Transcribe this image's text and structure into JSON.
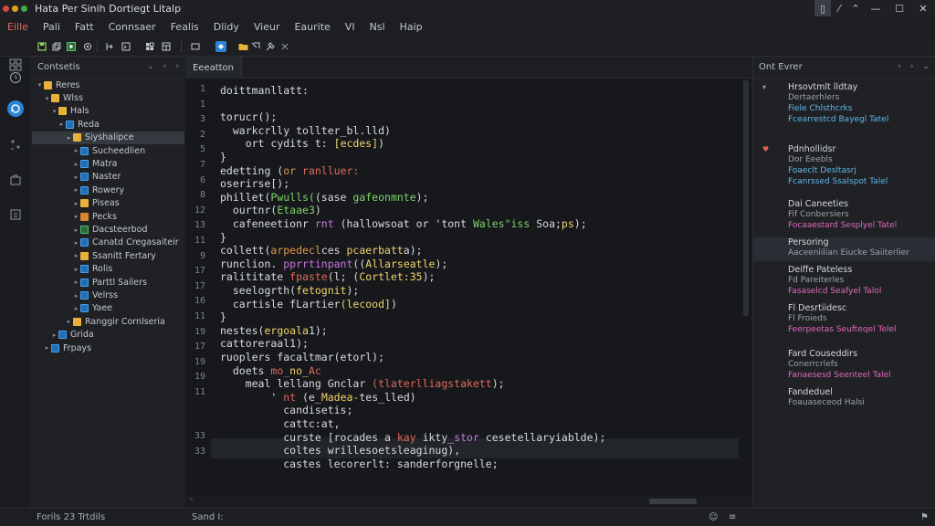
{
  "window": {
    "title": "Hata Per Sinih Dortiegt Litalp",
    "controls": [
      "▯",
      "⁄",
      "⌃",
      "—",
      "☐",
      "✕"
    ]
  },
  "colors": {
    "dot_red": "#e0443e",
    "dot_yellow": "#dea123",
    "dot_green": "#3fae3f",
    "accent": "#2a83d6"
  },
  "menu": [
    "Eille",
    "Pali",
    "Fatt",
    "Connsaer",
    "Fealis",
    "Dlidy",
    "Vieur",
    "Eaurite",
    "VI",
    "Nsl",
    "Haip"
  ],
  "toolbar": {
    "icons": [
      "save-icon",
      "copy-icon",
      "run-icon",
      "debug-icon",
      "split-icon",
      "terminal-icon",
      "extensions-icon",
      "layout-icon",
      "window-icon",
      "tab-icon",
      "folder-icon",
      "settings-icon",
      "tools-icon"
    ]
  },
  "activity": [
    "explorer-icon",
    "clock-icon",
    "account-icon",
    "extensions-icon",
    "debug-icon",
    "source-icon"
  ],
  "explorer": {
    "header": "Contsetis",
    "header_icons": [
      "⌄",
      "‹",
      "›"
    ],
    "items": [
      {
        "label": "Reres",
        "depth": 1,
        "icon": "folder",
        "chev": "▾"
      },
      {
        "label": "Wlss",
        "depth": 2,
        "icon": "folder",
        "chev": "▾"
      },
      {
        "label": "Hals",
        "depth": 3,
        "icon": "folder",
        "chev": "▾"
      },
      {
        "label": "Reda",
        "depth": 4,
        "icon": "file",
        "chev": "▸"
      },
      {
        "label": "Siyshalipce",
        "depth": 5,
        "icon": "folder",
        "chev": "▸",
        "selected": true
      },
      {
        "label": "Sucheedlien",
        "depth": 6,
        "icon": "file",
        "chev": "▸"
      },
      {
        "label": "Matra",
        "depth": 6,
        "icon": "file",
        "chev": "▸"
      },
      {
        "label": "Naster",
        "depth": 6,
        "icon": "file",
        "chev": "▸"
      },
      {
        "label": "Rowery",
        "depth": 6,
        "icon": "file",
        "chev": "▸"
      },
      {
        "label": "Piseas",
        "depth": 6,
        "icon": "folder",
        "chev": "▸"
      },
      {
        "label": "Pecks",
        "depth": 6,
        "icon": "orange",
        "chev": "▸"
      },
      {
        "label": "Dacsteerbod",
        "depth": 6,
        "icon": "green",
        "chev": "▸"
      },
      {
        "label": "Canatd Cregasaiteir",
        "depth": 6,
        "icon": "file",
        "chev": "▸"
      },
      {
        "label": "Ssanitt Fertary",
        "depth": 6,
        "icon": "folder",
        "chev": "▸"
      },
      {
        "label": "Rolis",
        "depth": 6,
        "icon": "file",
        "chev": "▸"
      },
      {
        "label": "Parttl Sailers",
        "depth": 6,
        "icon": "file",
        "chev": "▸"
      },
      {
        "label": "Velrss",
        "depth": 6,
        "icon": "file",
        "chev": "▸"
      },
      {
        "label": "Yaee",
        "depth": 6,
        "icon": "file",
        "chev": "▸"
      },
      {
        "label": "Ranggir Cornlseria",
        "depth": 5,
        "icon": "folder",
        "chev": "▸"
      },
      {
        "label": "Grida",
        "depth": 3,
        "icon": "file",
        "chev": "▸"
      },
      {
        "label": "Frpays",
        "depth": 2,
        "icon": "file",
        "chev": "▸"
      }
    ]
  },
  "editor": {
    "tab": "Eeeatton",
    "line_numbers": [
      "1",
      "1",
      "3",
      "2",
      "5",
      "7",
      "6",
      "8",
      "12",
      "13",
      "11",
      "9",
      "17",
      "17",
      "16",
      "11",
      "19",
      "17",
      "19",
      "19",
      "11",
      "33",
      "33"
    ],
    "lines": [
      [
        {
          "t": "doittmanllatt:",
          "c": "w"
        }
      ],
      [
        {
          "t": "",
          "c": "w"
        }
      ],
      [
        {
          "t": "torucr();",
          "c": "w"
        }
      ],
      [
        {
          "t": "  warkcrlly ",
          "c": "w"
        },
        {
          "t": "tollter_",
          "c": "w"
        },
        {
          "t": "bl.lld)",
          "c": "w"
        }
      ],
      [
        {
          "t": "    ort ",
          "c": "w"
        },
        {
          "t": "cydits",
          "c": "w"
        },
        {
          "t": " t: ",
          "c": "w"
        },
        {
          "t": "[ecdes]",
          "c": "y"
        },
        {
          "t": ")",
          "c": "w"
        }
      ],
      [
        {
          "t": "}",
          "c": "w"
        }
      ],
      [
        {
          "t": "edetting ",
          "c": "w"
        },
        {
          "t": "(",
          "c": "w"
        },
        {
          "t": "or ",
          "c": "o"
        },
        {
          "t": "ranlluer:",
          "c": "r"
        }
      ],
      [
        {
          "t": "oserirse[);",
          "c": "w"
        }
      ],
      [
        {
          "t": "phillet(",
          "c": "w"
        },
        {
          "t": "Pwulls(",
          "c": "g"
        },
        {
          "t": "(sase ",
          "c": "w"
        },
        {
          "t": "gafeonmnte",
          "c": "g"
        },
        {
          "t": ");",
          "c": "w"
        }
      ],
      [
        {
          "t": "  ourtnr",
          "c": "w"
        },
        {
          "t": "(",
          "c": "w"
        },
        {
          "t": "Etaae3",
          "c": "g"
        },
        {
          "t": ")",
          "c": "w"
        }
      ],
      [
        {
          "t": "  cafeneetionr ",
          "c": "w"
        },
        {
          "t": "rnt ",
          "c": "p"
        },
        {
          "t": "(hallowsoat or 'tont ",
          "c": "w"
        },
        {
          "t": "Wales\"iss ",
          "c": "g"
        },
        {
          "t": "Soa;",
          "c": "w"
        },
        {
          "t": "ps",
          "c": "y"
        },
        {
          "t": ");",
          "c": "w"
        }
      ],
      [
        {
          "t": "}",
          "c": "w"
        }
      ],
      [
        {
          "t": "collett(",
          "c": "w"
        },
        {
          "t": "arpedecl",
          "c": "o"
        },
        {
          "t": "ces ",
          "c": "w"
        },
        {
          "t": "pcaerbatt",
          "c": "y"
        },
        {
          "t": "a);",
          "c": "w"
        }
      ],
      [
        {
          "t": "runclion. ",
          "c": "w"
        },
        {
          "t": "pprrtinpant",
          "c": "p"
        },
        {
          "t": "((",
          "c": "w"
        },
        {
          "t": "Allarseatle",
          "c": "y"
        },
        {
          "t": ");",
          "c": "w"
        }
      ],
      [
        {
          "t": "ralititate ",
          "c": "w"
        },
        {
          "t": "fpaste",
          "c": "r"
        },
        {
          "t": "(l; (",
          "c": "w"
        },
        {
          "t": "Cortlet:35",
          "c": "y"
        },
        {
          "t": ");",
          "c": "w"
        }
      ],
      [
        {
          "t": "  seelogrth(",
          "c": "w"
        },
        {
          "t": "fetognit",
          "c": "y"
        },
        {
          "t": ");",
          "c": "w"
        }
      ],
      [
        {
          "t": "  cartisle ",
          "c": "w"
        },
        {
          "t": "fLartier",
          "c": "w"
        },
        {
          "t": "(lecood]",
          "c": "y"
        },
        {
          "t": ")",
          "c": "w"
        }
      ],
      [
        {
          "t": "}",
          "c": "w"
        }
      ],
      [
        {
          "t": "nestes(",
          "c": "w"
        },
        {
          "t": "ergoala",
          "c": "y"
        },
        {
          "t": "1);",
          "c": "w"
        }
      ],
      [
        {
          "t": "cattoreraal",
          "c": "w"
        },
        {
          "t": "1",
          "c": "w"
        },
        {
          "t": ");",
          "c": "w"
        }
      ],
      [
        {
          "t": "ruoplers ",
          "c": "w"
        },
        {
          "t": "facaltmar",
          "c": "w"
        },
        {
          "t": "(etorl);",
          "c": "w"
        }
      ],
      [
        {
          "t": "  doets ",
          "c": "w"
        },
        {
          "t": "mo_",
          "c": "r"
        },
        {
          "t": "no_",
          "c": "y"
        },
        {
          "t": "Ac",
          "c": "r"
        }
      ],
      [
        {
          "t": "    meal ",
          "c": "w"
        },
        {
          "t": "lellang ",
          "c": "w"
        },
        {
          "t": "Gnclar ",
          "c": "w"
        },
        {
          "t": "(tlaterlliagstakett",
          "c": "r"
        },
        {
          "t": ");",
          "c": "w"
        }
      ],
      [
        {
          "t": "        ' ",
          "c": "w"
        },
        {
          "t": "nt ",
          "c": "r"
        },
        {
          "t": "(e_",
          "c": "w"
        },
        {
          "t": "Madea-",
          "c": "y"
        },
        {
          "t": "tes_lled)",
          "c": "w"
        }
      ],
      [
        {
          "t": "          candisetis;",
          "c": "w"
        }
      ],
      [
        {
          "t": "          cattc:at,",
          "c": "w"
        }
      ],
      [
        {
          "t": "          curste ",
          "c": "w"
        },
        {
          "t": "[rocades ",
          "c": "w"
        },
        {
          "t": "a ",
          "c": "w"
        },
        {
          "t": "kay ",
          "c": "r"
        },
        {
          "t": "ikty_",
          "c": "w"
        },
        {
          "t": "stor ",
          "c": "p"
        },
        {
          "t": "cesetellaryiablde);",
          "c": "w"
        }
      ],
      [
        {
          "t": "          coltes ",
          "c": "w"
        },
        {
          "t": "wrillesoetsleaginug)",
          "c": "w"
        },
        {
          "t": ",",
          "c": "w"
        }
      ],
      [
        {
          "t": "          castes ",
          "c": "w"
        },
        {
          "t": "lecorerlt",
          "c": "w"
        },
        {
          "t": ": ",
          "c": "w"
        },
        {
          "t": "sanderforgnelle;",
          "c": "w"
        }
      ]
    ]
  },
  "outline": {
    "header": "Ont Evrer",
    "header_icons": [
      "‹",
      "›",
      "⌄"
    ],
    "items": [
      {
        "title": "Hrsovtmlt lldtay",
        "sub": "Dertaerhlers",
        "link": "Fiele Chlsthcrks",
        "extra": "Fcearrestcd Bayegl Tatel"
      },
      {
        "title": "Pdnhollidsr",
        "sub": "Dor Eeebls",
        "link": "Foaeclt Desltasrj",
        "extra": "Fcanrssed Ssalspot Talel"
      },
      {
        "title": "Dai Caneeties",
        "sub": "Fif Conbersiers",
        "link": "Focaaestard Sesplyel Tatel",
        "extra": ""
      },
      {
        "title": "Persoring",
        "sub": "Aaceeniilian Eiucke Saiiterlier",
        "link": "",
        "extra": ""
      },
      {
        "title": "Deiffe Pateless",
        "sub": "Fd Pareiterles",
        "link": "Fasaselcd Seafyel Talol",
        "extra": ""
      },
      {
        "title": "Fl Desrtiidesc",
        "sub": "Fl Froieds",
        "link": "Feerpeetas Seufteqel Telel",
        "extra": ""
      },
      {
        "title": "Fard Couseddirs",
        "sub": "Conerrcrlefs",
        "link": "Fanaesesd Seenteel Talel",
        "extra": ""
      },
      {
        "title": "Fandeduel",
        "sub": "Foauaseceod Halsi",
        "link": "",
        "extra": ""
      }
    ]
  },
  "status": {
    "left": "Forils 23 Trtdils",
    "mid": "Sand I:",
    "right_icons": [
      "☺",
      "≡",
      "⚑"
    ]
  }
}
